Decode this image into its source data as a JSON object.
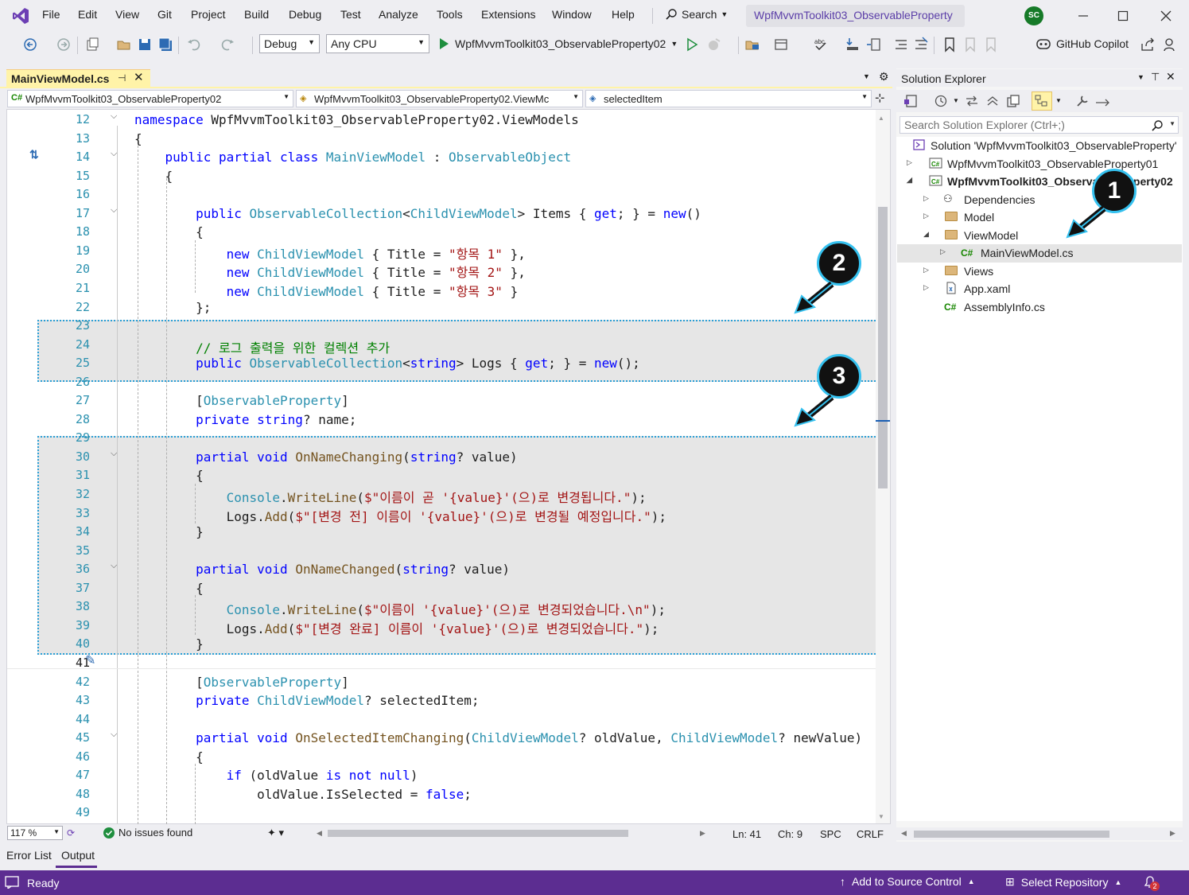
{
  "menu": {
    "items": [
      "File",
      "Edit",
      "View",
      "Git",
      "Project",
      "Build",
      "Debug",
      "Test",
      "Analyze",
      "Tools",
      "Extensions",
      "Window",
      "Help"
    ],
    "search_label": "Search",
    "window_title": "WpfMvvmToolkit03_ObservableProperty",
    "avatar_initials": "SC"
  },
  "toolbar": {
    "config": "Debug",
    "platform": "Any CPU",
    "startup_project": "WpfMvvmToolkit03_ObservableProperty02",
    "copilot_label": "GitHub Copilot"
  },
  "editor": {
    "tab_label": "MainViewModel.cs",
    "nav_project": "WpfMvvmToolkit03_ObservableProperty02",
    "nav_type": "WpfMvvmToolkit03_ObservableProperty02.ViewMc",
    "nav_member": "selectedItem",
    "lines": [
      {
        "n": "12",
        "code": "namespace WpfMvvmToolkit03_ObservableProperty02.ViewModels"
      },
      {
        "n": "13",
        "code": "{"
      },
      {
        "n": "14",
        "code": "    public partial class MainViewModel : ObservableObject"
      },
      {
        "n": "15",
        "code": "    {"
      },
      {
        "n": "16",
        "code": ""
      },
      {
        "n": "17",
        "code": "        public ObservableCollection<ChildViewModel> Items { get; } = new()"
      },
      {
        "n": "18",
        "code": "        {"
      },
      {
        "n": "19",
        "code": "            new ChildViewModel { Title = \"항목 1\" },"
      },
      {
        "n": "20",
        "code": "            new ChildViewModel { Title = \"항목 2\" },"
      },
      {
        "n": "21",
        "code": "            new ChildViewModel { Title = \"항목 3\" }"
      },
      {
        "n": "22",
        "code": "        };"
      },
      {
        "n": "23",
        "code": ""
      },
      {
        "n": "24",
        "code": "        // 로그 출력을 위한 컬렉션 추가"
      },
      {
        "n": "25",
        "code": "        public ObservableCollection<string> Logs { get; } = new();"
      },
      {
        "n": "26",
        "code": ""
      },
      {
        "n": "27",
        "code": "        [ObservableProperty]"
      },
      {
        "n": "28",
        "code": "        private string? name;"
      },
      {
        "n": "29",
        "code": ""
      },
      {
        "n": "30",
        "code": "        partial void OnNameChanging(string? value)"
      },
      {
        "n": "31",
        "code": "        {"
      },
      {
        "n": "32",
        "code": "            Console.WriteLine($\"이름이 곧 '{value}'(으)로 변경됩니다.\");"
      },
      {
        "n": "33",
        "code": "            Logs.Add($\"[변경 전] 이름이 '{value}'(으)로 변경될 예정입니다.\");"
      },
      {
        "n": "34",
        "code": "        }"
      },
      {
        "n": "35",
        "code": ""
      },
      {
        "n": "36",
        "code": "        partial void OnNameChanged(string? value)"
      },
      {
        "n": "37",
        "code": "        {"
      },
      {
        "n": "38",
        "code": "            Console.WriteLine($\"이름이 '{value}'(으)로 변경되었습니다.\\n\");"
      },
      {
        "n": "39",
        "code": "            Logs.Add($\"[변경 완료] 이름이 '{value}'(으)로 변경되었습니다.\");"
      },
      {
        "n": "40",
        "code": "        }"
      },
      {
        "n": "41",
        "code": ""
      },
      {
        "n": "42",
        "code": "        [ObservableProperty]"
      },
      {
        "n": "43",
        "code": "        private ChildViewModel? selectedItem;"
      },
      {
        "n": "44",
        "code": ""
      },
      {
        "n": "45",
        "code": "        partial void OnSelectedItemChanging(ChildViewModel? oldValue, ChildViewModel? newValue)"
      },
      {
        "n": "46",
        "code": "        {"
      },
      {
        "n": "47",
        "code": "            if (oldValue is not null)"
      },
      {
        "n": "48",
        "code": "                oldValue.IsSelected = false;"
      },
      {
        "n": "49",
        "code": ""
      }
    ],
    "status": {
      "zoom": "117 %",
      "issues": "No issues found",
      "ln": "Ln: 41",
      "ch": "Ch: 9",
      "spc": "SPC",
      "eol": "CRLF"
    }
  },
  "callouts": [
    "1",
    "2",
    "3"
  ],
  "solution_explorer": {
    "title": "Solution Explorer",
    "search_placeholder": "Search Solution Explorer (Ctrl+;)",
    "items": [
      {
        "label": "Solution 'WpfMvvmToolkit03_ObservableProperty'"
      },
      {
        "label": "WpfMvvmToolkit03_ObservableProperty01"
      },
      {
        "label": "WpfMvvmToolkit03_ObservableProperty02"
      },
      {
        "label": "Dependencies"
      },
      {
        "label": "Model"
      },
      {
        "label": "ViewModel"
      },
      {
        "label": "MainViewModel.cs"
      },
      {
        "label": "Views"
      },
      {
        "label": "App.xaml"
      },
      {
        "label": "AssemblyInfo.cs"
      }
    ]
  },
  "bottom_tabs": [
    "Error List",
    "Output"
  ],
  "status_bar": {
    "ready": "Ready",
    "source_control": "Add to Source Control",
    "repository": "Select Repository",
    "notifications": "2"
  },
  "colors": {
    "accent": "#5c2d91",
    "keyword": "#0000ff",
    "type": "#2b91af",
    "string": "#a31515",
    "comment": "#008000",
    "callout_border": "#35c1ef"
  }
}
